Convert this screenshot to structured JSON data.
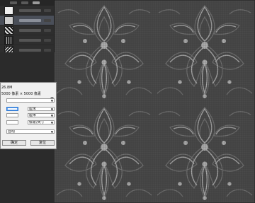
{
  "layers_panel": {
    "rows": [
      {
        "name": "",
        "thumb": "tex5",
        "selected": false
      },
      {
        "name": "",
        "thumb": "tex1",
        "selected": true
      },
      {
        "name": "",
        "thumb": "tex2",
        "selected": false
      },
      {
        "name": "",
        "thumb": "tex3",
        "selected": false
      },
      {
        "name": "",
        "thumb": "tex4",
        "selected": false
      }
    ]
  },
  "dialog": {
    "size_label": "",
    "size_value": "26.8M",
    "dimension_label": "",
    "dimension_value": "5000 像素 × 5000 像素",
    "dropdown_value": "",
    "width_value": "",
    "width_unit": "厘米",
    "height_value": "",
    "height_unit": "厘米",
    "resolution_value": "",
    "resolution_unit": "像素/英寸",
    "resample_label": "",
    "resample_value": "自动",
    "ok_label": "确定",
    "reset_label": "复位"
  },
  "colors": {
    "canvas_background": "#090909",
    "pattern_light": "#b8b8b8",
    "pattern_mid": "#707070",
    "pattern_dark": "#2a2a2a",
    "panel_background": "#2e2e2e",
    "selected_row": "#4a4f59"
  },
  "icons": [
    "gear-icon",
    "dropdown-arrow-icon",
    "layer-thumbnail"
  ]
}
